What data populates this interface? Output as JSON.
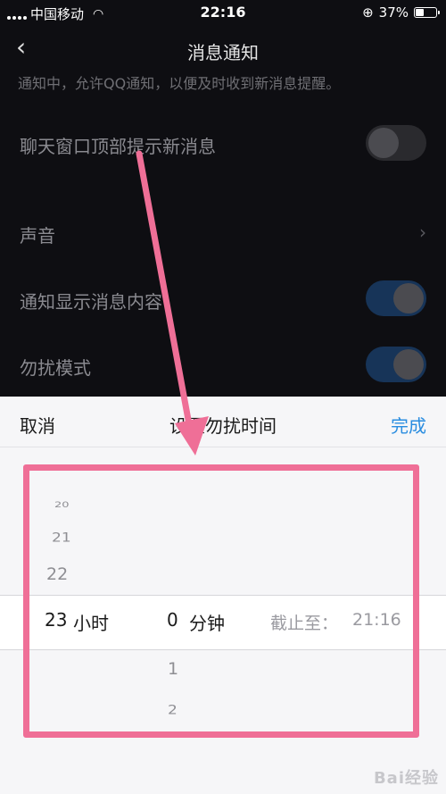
{
  "status_bar": {
    "carrier": "中国移动",
    "time": "22:16",
    "battery": "37%"
  },
  "nav": {
    "title": "消息通知"
  },
  "hint": "通知中，允许QQ通知，以便及时收到新消息提醒。",
  "settings": {
    "top_banner": {
      "label": "聊天窗口顶部提示新消息",
      "enabled": false
    },
    "sound": {
      "label": "声音"
    },
    "show_content": {
      "label": "通知显示消息内容",
      "enabled": true
    },
    "dnd": {
      "label": "勿扰模式",
      "enabled": true
    }
  },
  "sheet": {
    "cancel": "取消",
    "title": "设置勿扰时间",
    "done": "完成",
    "hours_above": [
      "20",
      "21",
      "22"
    ],
    "selected_hour": "23",
    "hour_unit": "小时",
    "selected_minute": "0",
    "minute_unit": "分钟",
    "minutes_below": [
      "1",
      "2"
    ],
    "until_label": "截止至：",
    "until_time": "21:16"
  },
  "watermark": "Bai经验",
  "colors": {
    "accent": "#2a8de0",
    "highlight": "#ef6f97"
  }
}
